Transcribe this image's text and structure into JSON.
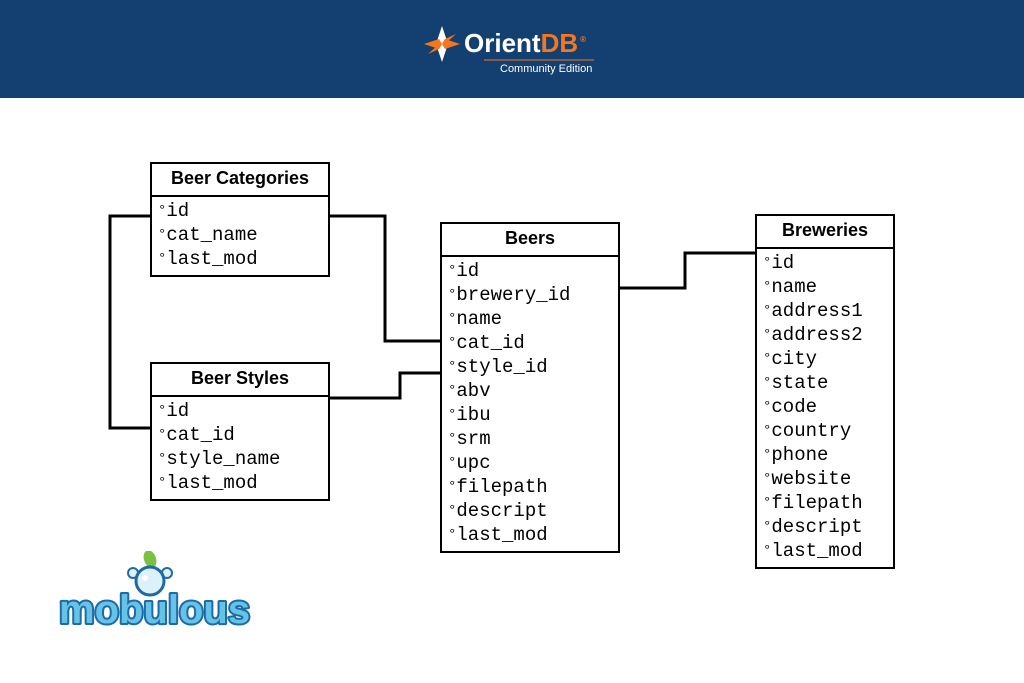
{
  "header": {
    "brand_prefix": "Orient",
    "brand_suffix": "DB",
    "brand_color_prefix": "#ffffff",
    "brand_color_suffix": "#f4761f",
    "brand_r_mark": "®",
    "brand_subtitle": "Community Edition",
    "brand_bg": "#134070",
    "star_color_orange": "#f4761f",
    "star_color_white": "#ffffff"
  },
  "entities": {
    "beer_categories": {
      "title": "Beer Categories",
      "fields": [
        "id",
        "cat_name",
        "last_mod"
      ]
    },
    "beer_styles": {
      "title": "Beer Styles",
      "fields": [
        "id",
        "cat_id",
        "style_name",
        "last_mod"
      ]
    },
    "beers": {
      "title": "Beers",
      "fields": [
        "id",
        "brewery_id",
        "name",
        "cat_id",
        "style_id",
        "abv",
        "ibu",
        "srm",
        "upc",
        "filepath",
        "descript",
        "last_mod"
      ]
    },
    "breweries": {
      "title": "Breweries",
      "fields": [
        "id",
        "name",
        "address1",
        "address2",
        "city",
        "state",
        "code",
        "country",
        "phone",
        "website",
        "filepath",
        "descript",
        "last_mod"
      ]
    }
  },
  "footer_logo": {
    "text": "mobulous",
    "fill": "#65c3e8",
    "stroke": "#1e6aa5",
    "leaf_color": "#7ac142"
  }
}
